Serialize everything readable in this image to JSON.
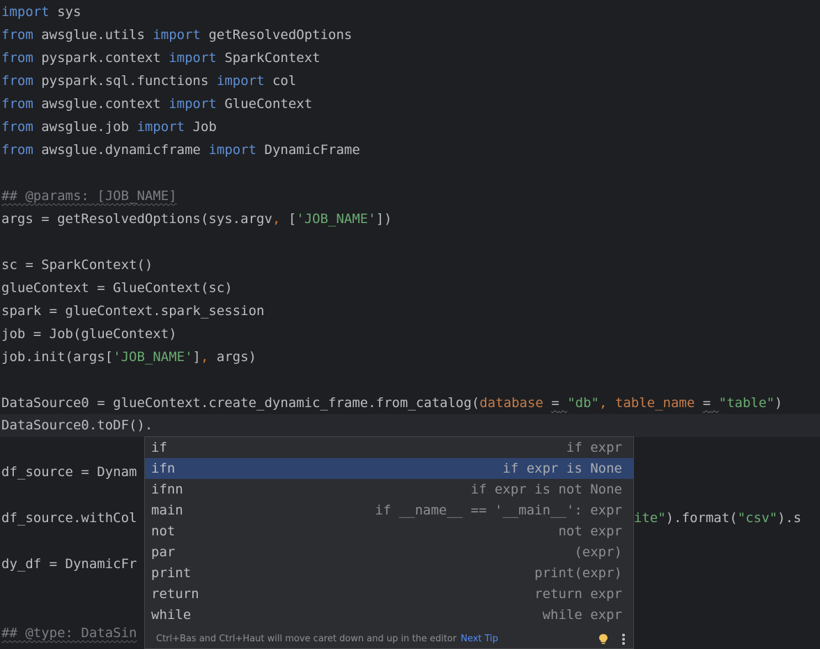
{
  "code": {
    "l1": [
      "import",
      " sys"
    ],
    "l2": [
      "from",
      " awsglue.utils ",
      "import",
      " getResolvedOptions"
    ],
    "l3": [
      "from",
      " pyspark.context ",
      "import",
      " SparkContext"
    ],
    "l4": [
      "from",
      " pyspark.sql.functions ",
      "import",
      " col"
    ],
    "l5": [
      "from",
      " awsglue.context ",
      "import",
      " GlueContext"
    ],
    "l6": [
      "from",
      " awsglue.job ",
      "import",
      " Job"
    ],
    "l7": [
      "from",
      " awsglue.dynamicframe ",
      "import",
      " DynamicFrame"
    ],
    "l9": "## @params: [JOB_NAME]",
    "l10": [
      "args = getResolvedOptions(sys.argv",
      ",",
      " [",
      "'JOB_NAME'",
      "])"
    ],
    "l12": "sc = SparkContext()",
    "l13": "glueContext = GlueContext(sc)",
    "l14": "spark = glueContext.spark_session",
    "l15": "job = Job(glueContext)",
    "l16": [
      "job.init(args[",
      "'JOB_NAME'",
      "]",
      ",",
      " args)"
    ],
    "l18": [
      "DataSource0 = glueContext.create_dynamic_frame.from_catalog(",
      "database",
      " ",
      "=",
      " ",
      "\"db\"",
      ",",
      " ",
      "table_name",
      " ",
      "=",
      " ",
      "\"table\"",
      ")"
    ],
    "l19": "DataSource0.toDF().",
    "l21": "df_source = Dynam",
    "l23": [
      "df_source.withCol",
      "rite\"",
      ").format(",
      "\"csv\"",
      ").s"
    ],
    "l25": "dy_df = DynamicFr",
    "l28": "## @type: DataSin"
  },
  "completion": {
    "items": [
      {
        "name": "if",
        "desc": "if expr"
      },
      {
        "name": "ifn",
        "desc": "if expr is None"
      },
      {
        "name": "ifnn",
        "desc": "if expr is not None"
      },
      {
        "name": "main",
        "desc": "if __name__ == '__main__': expr"
      },
      {
        "name": "not",
        "desc": "not expr"
      },
      {
        "name": "par",
        "desc": "(expr)"
      },
      {
        "name": "print",
        "desc": "print(expr)"
      },
      {
        "name": "return",
        "desc": "return expr"
      },
      {
        "name": "while",
        "desc": "while expr"
      }
    ],
    "selected_index": 1,
    "footer_tip": "Ctrl+Bas and Ctrl+Haut will move caret down and up in the editor",
    "next_tip_label": "Next Tip",
    "icons": {
      "tip": "lightbulb-icon",
      "menu": "more-vertical-icon"
    }
  },
  "colors": {
    "background": "#1e1f22",
    "keyword": "#5f8fd6",
    "string": "#6aab73",
    "parameter": "#c77c4a",
    "selection": "#2e436e",
    "link": "#548af7"
  }
}
